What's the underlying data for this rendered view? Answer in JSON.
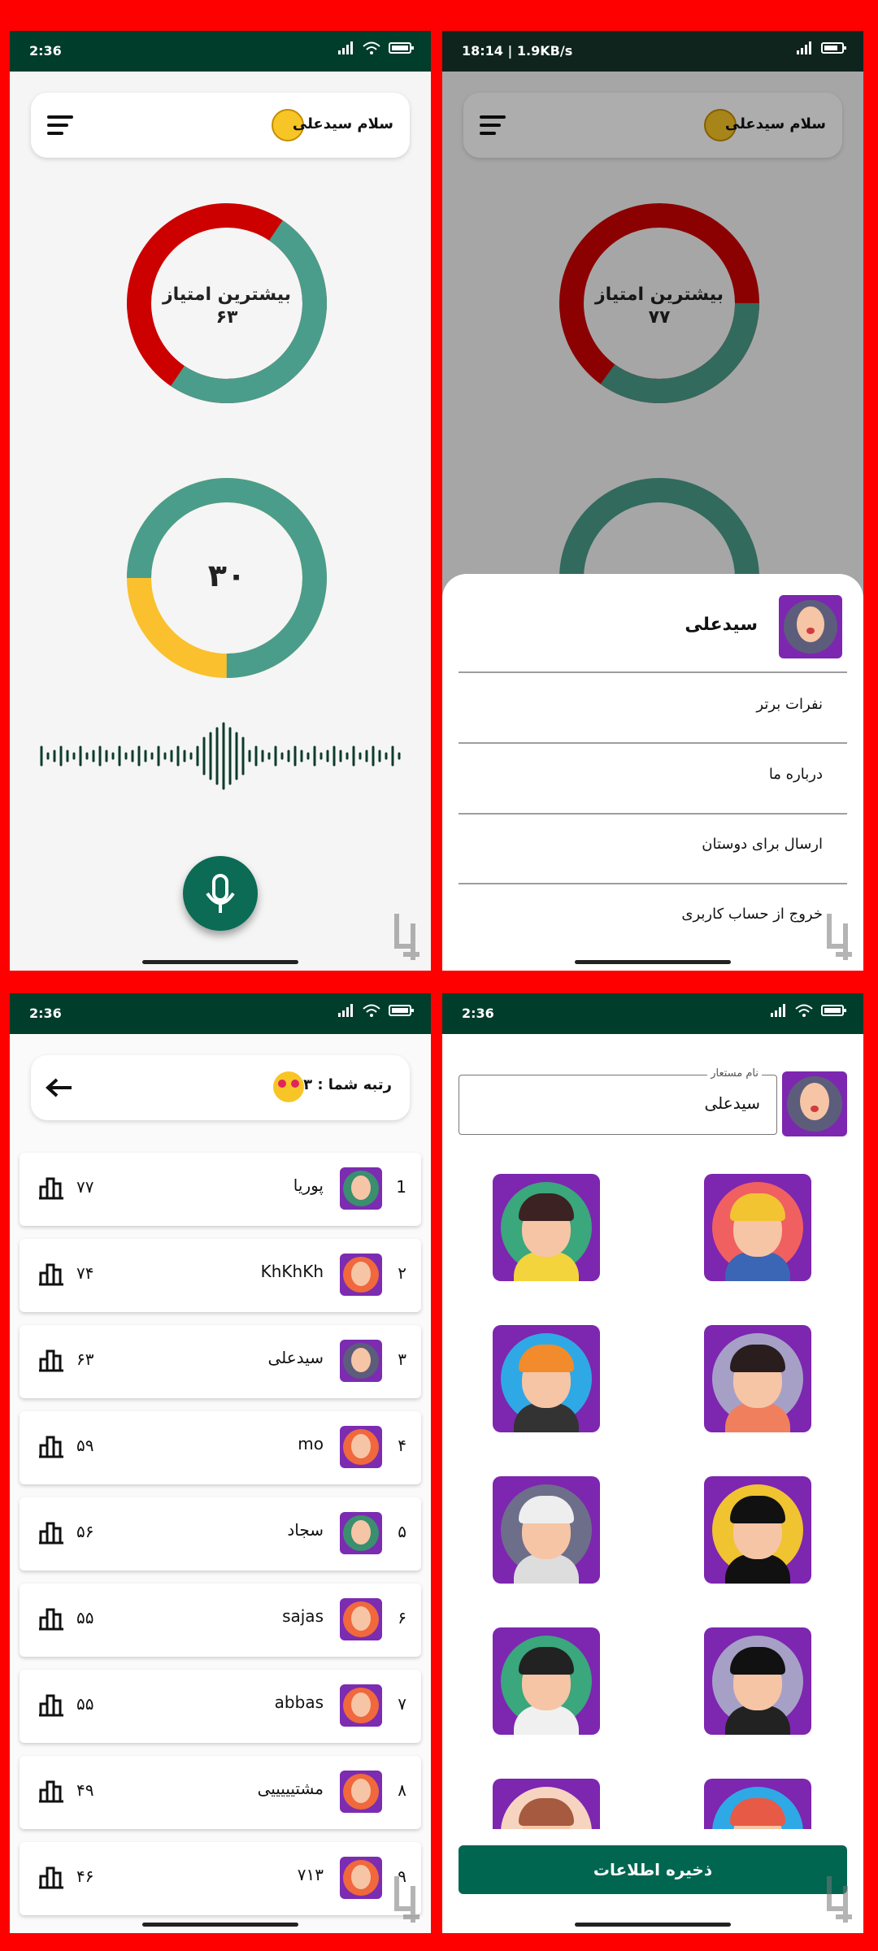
{
  "colors": {
    "primary_dark": "#003d2b",
    "teal": "#4a9d8b",
    "red": "#cd0000",
    "yellow": "#fbc02d",
    "frame": "#fe0000",
    "button": "#006650",
    "avatar_bg": "#7d26b0"
  },
  "panel_home": {
    "status_time": "2:36",
    "greeting": "سلام سیدعلی",
    "best_score_title": "بیشترین امتیاز",
    "best_score_value": "۶۳",
    "best_score_fraction": 0.63,
    "timer_value": "۳۰",
    "timer_fraction": 0.75,
    "mic_icon": "microphone-icon",
    "menu_icon": "hamburger-icon"
  },
  "panel_menu": {
    "status_time": "18:14 | 1.9KB/s",
    "greeting": "سلام سیدعلی",
    "best_score_title": "بیشترین امتیاز",
    "best_score_value": "۷۷",
    "best_score_fraction": 0.77,
    "user_name": "سیدعلی",
    "items": [
      {
        "label": "نفرات برتر"
      },
      {
        "label": "درباره ما"
      },
      {
        "label": "ارسال برای دوستان"
      },
      {
        "label": "خروج از حساب کاربری"
      }
    ]
  },
  "panel_leaderboard": {
    "status_time": "2:36",
    "rank_label": "رتبه شما : ۳",
    "rows": [
      {
        "rank": "1",
        "name": "پوریا",
        "score": "۷۷"
      },
      {
        "rank": "۲",
        "name": "KhKhKh",
        "score": "۷۴"
      },
      {
        "rank": "۳",
        "name": "سیدعلی",
        "score": "۶۳"
      },
      {
        "rank": "۴",
        "name": "mo",
        "score": "۵۹"
      },
      {
        "rank": "۵",
        "name": "سجاد",
        "score": "۵۶"
      },
      {
        "rank": "۶",
        "name": "sajas",
        "score": "۵۵"
      },
      {
        "rank": "۷",
        "name": "abbas",
        "score": "۵۵"
      },
      {
        "rank": "۸",
        "name": "مشتیییییی",
        "score": "۴۹"
      },
      {
        "rank": "۹",
        "name": "۷۱۳",
        "score": "۴۶"
      }
    ]
  },
  "panel_profile": {
    "status_time": "2:36",
    "field_label": "نام مستعار",
    "field_value": "سیدعلی",
    "save_label": "ذخیره اطلاعات"
  }
}
